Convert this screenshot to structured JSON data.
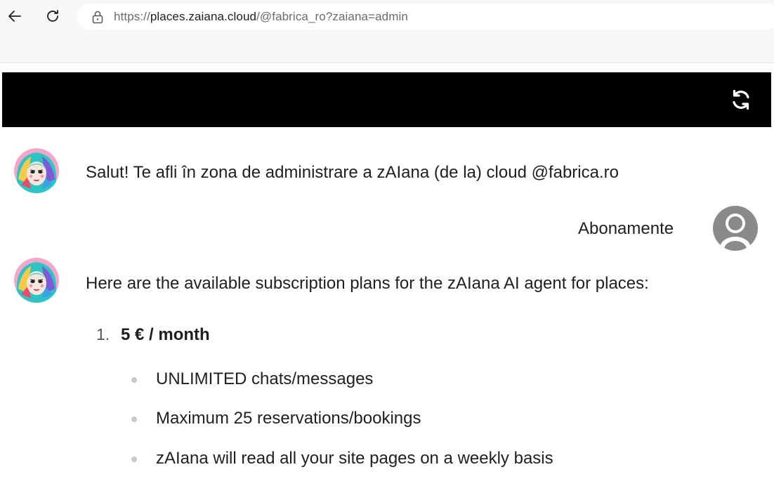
{
  "browser": {
    "url_prefix": "https://",
    "url_host": "places.zaiana.cloud",
    "url_path": "/@fabrica_ro?zaiana=admin"
  },
  "messages": {
    "greeting": "Salut! Te afli în zona de administrare a zAIana (de la) cloud @fabrica.ro",
    "user_message": "Abonamente",
    "plans_intro": "Here are the available subscription plans for the zAIana AI agent for places:"
  },
  "plans": [
    {
      "number": "1.",
      "title": "5 € / month",
      "features": [
        "UNLIMITED chats/messages",
        "Maximum 25 reservations/bookings",
        "zAIana will read all your site pages on a weekly basis"
      ]
    }
  ],
  "icons": {
    "back": "arrow-left-icon",
    "reload": "reload-icon",
    "lock": "lock-icon",
    "refresh": "sync-icon",
    "bot_avatar": "bot-avatar",
    "user_avatar": "user-avatar"
  },
  "colors": {
    "header_bg": "#000000",
    "user_avatar": "#8a8a8a",
    "bullet": "#c9c9c9"
  }
}
